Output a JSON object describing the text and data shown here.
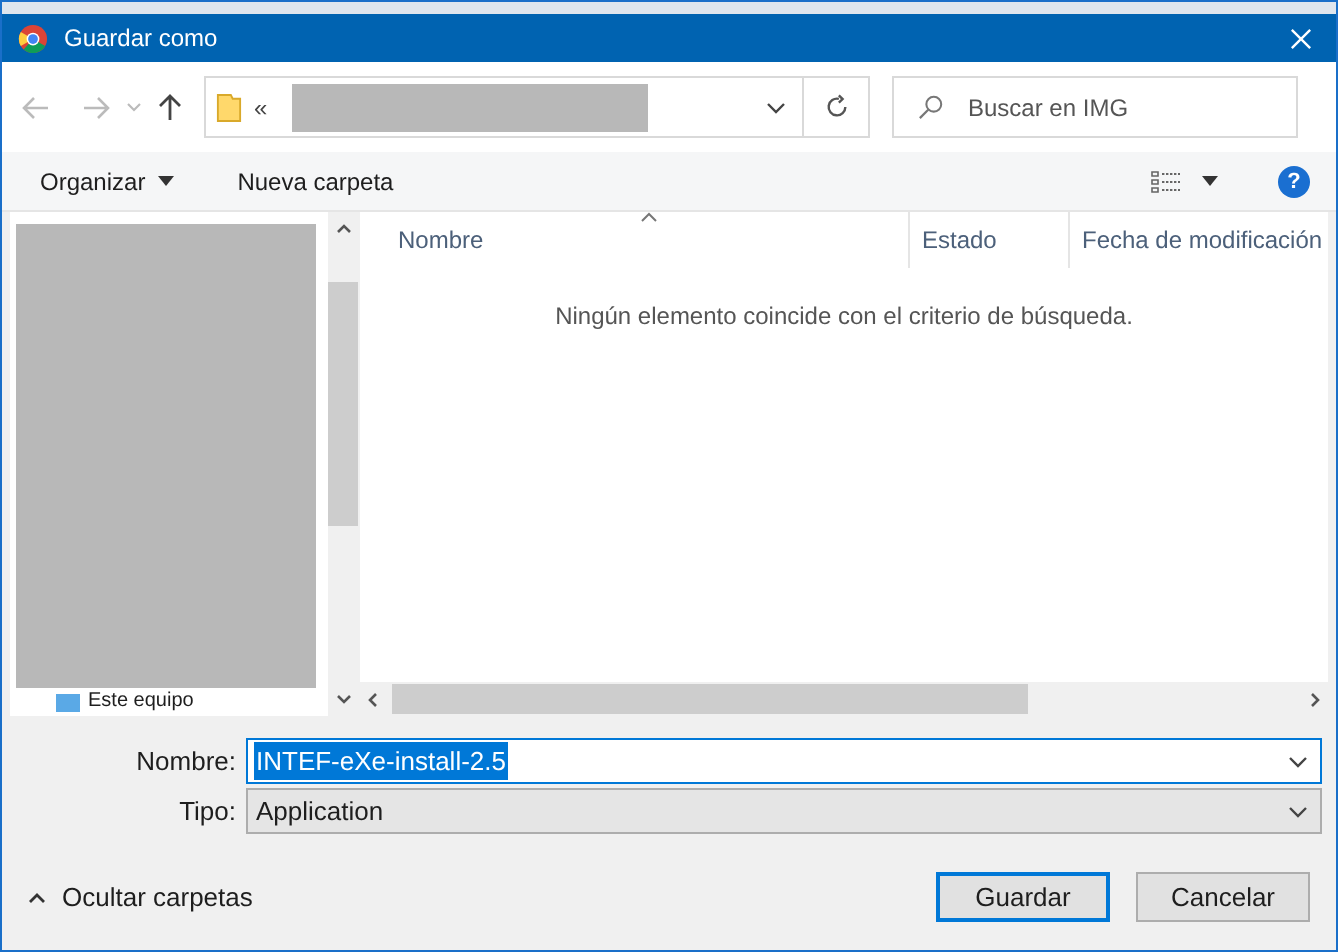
{
  "window": {
    "title": "Guardar como"
  },
  "address": {
    "prefix": "«"
  },
  "search": {
    "placeholder": "Buscar en IMG"
  },
  "toolbar": {
    "organize": "Organizar",
    "new_folder": "Nueva carpeta"
  },
  "sidebar": {
    "items": [
      {
        "label": "Este equipo"
      }
    ]
  },
  "columns": [
    {
      "label": "Nombre",
      "sorted": true
    },
    {
      "label": "Estado",
      "sorted": false
    },
    {
      "label": "Fecha de modificación",
      "sorted": false
    }
  ],
  "empty_message": "Ningún elemento coincide con el criterio de búsqueda.",
  "fields": [
    {
      "label": "Nombre:",
      "value": "INTEF-eXe-install-2.5",
      "kind": "edit",
      "text_selected": true
    },
    {
      "label": "Tipo:",
      "value": "Application",
      "kind": "select",
      "text_selected": false
    }
  ],
  "help": "?",
  "hide_folders": "Ocultar carpetas",
  "buttons": [
    {
      "label": "Guardar",
      "default": true
    },
    {
      "label": "Cancelar",
      "default": false
    }
  ]
}
